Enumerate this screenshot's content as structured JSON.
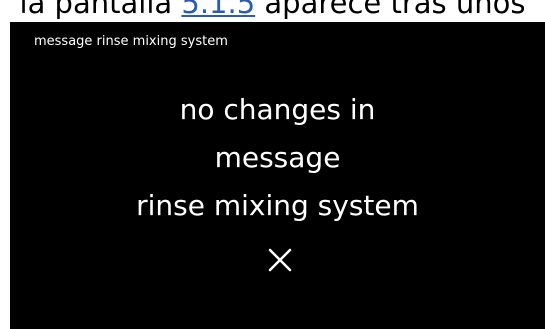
{
  "document": {
    "text_before": "la pantalla ",
    "link_text": "5.1.5",
    "text_after": " aparece tras unos"
  },
  "screen": {
    "title": "message rinse mixing system",
    "message_lines": [
      "no changes in",
      "message",
      "rinse mixing system"
    ],
    "close_icon": "close-icon"
  },
  "colors": {
    "screen_background": "#000000",
    "screen_text": "#ffffff",
    "link": "#2a5db0"
  }
}
